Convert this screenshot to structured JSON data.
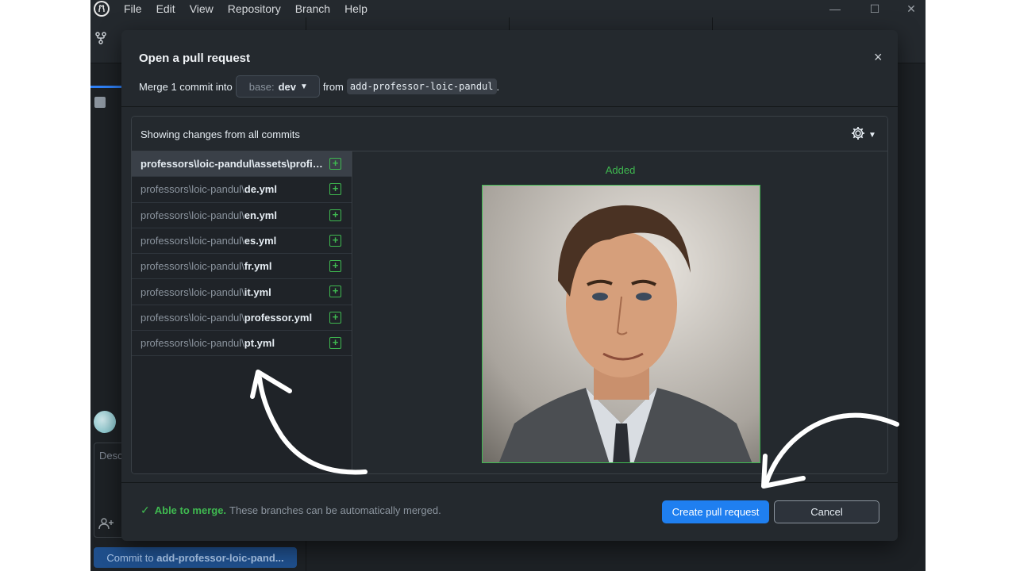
{
  "menubar": {
    "items": [
      "File",
      "Edit",
      "View",
      "Repository",
      "Branch",
      "Help"
    ]
  },
  "window_controls": {
    "minimize": "—",
    "maximize": "☐",
    "close": "✕"
  },
  "sidebar": {
    "description_placeholder": "Desc",
    "commit_button": {
      "prefix": "Commit to ",
      "branch": "add-professor-loic-pand..."
    }
  },
  "dialog": {
    "title": "Open a pull request",
    "close_icon": "×",
    "merge_text": "Merge 1 commit into",
    "base_prefix": "base:",
    "base_value": "dev",
    "from_text": "from",
    "source_branch": "add-professor-loic-pandul",
    "period": ".",
    "changes_header": "Showing changes from all commits",
    "files": [
      {
        "prefix": "professors\\loic-pandul\\assets\\profile.png",
        "name": "",
        "selected": true
      },
      {
        "prefix": "professors\\loic-pandul\\",
        "name": "de.yml"
      },
      {
        "prefix": "professors\\loic-pandul\\",
        "name": "en.yml"
      },
      {
        "prefix": "professors\\loic-pandul\\",
        "name": "es.yml"
      },
      {
        "prefix": "professors\\loic-pandul\\",
        "name": "fr.yml"
      },
      {
        "prefix": "professors\\loic-pandul\\",
        "name": "it.yml"
      },
      {
        "prefix": "professors\\loic-pandul\\",
        "name": "professor.yml"
      },
      {
        "prefix": "professors\\loic-pandul\\",
        "name": "pt.yml"
      }
    ],
    "preview_label": "Added",
    "merge_status": {
      "ok": "Able to merge.",
      "detail": "These branches can be automatically merged."
    },
    "create_button": "Create pull request",
    "cancel_button": "Cancel"
  },
  "colors": {
    "accent_blue": "#1f7ff0",
    "added_green": "#3fb950",
    "modal_bg": "#24292e"
  }
}
